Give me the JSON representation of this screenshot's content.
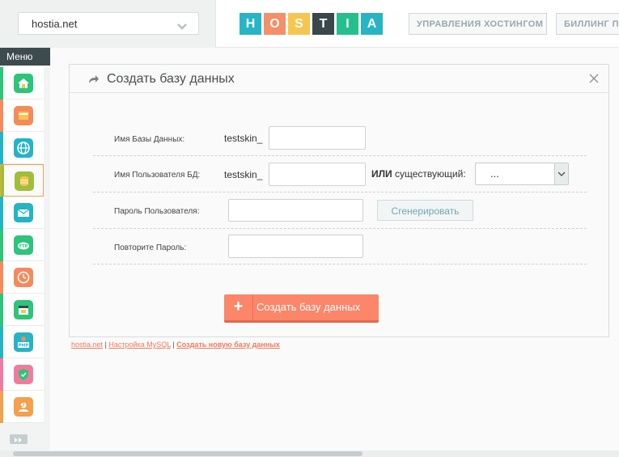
{
  "header": {
    "domain_selector": {
      "value": "hostia.net"
    },
    "logo_letters": [
      {
        "char": "H",
        "color": "#27b5c5"
      },
      {
        "char": "O",
        "color": "#f58f68"
      },
      {
        "char": "S",
        "color": "#f6c64e"
      },
      {
        "char": "T",
        "color": "#3a474b"
      },
      {
        "char": "I",
        "color": "#25bf8d"
      },
      {
        "char": "A",
        "color": "#27b5c5"
      }
    ],
    "nav": [
      {
        "label": "УПРАВЛЕНИЯ ХОСТИНГОМ"
      },
      {
        "label": "БИЛЛИНГ П"
      }
    ]
  },
  "sidebar": {
    "menu_label": "Меню",
    "items": [
      {
        "icon": "home-icon",
        "color": "#2cc57a"
      },
      {
        "icon": "folder-icon",
        "color": "#f58a5a"
      },
      {
        "icon": "www-globe-icon",
        "color": "#25b3c6"
      },
      {
        "icon": "database-icon",
        "color": "#9fbf3b",
        "active": true
      },
      {
        "icon": "mail-icon",
        "color": "#25b3c6"
      },
      {
        "icon": "ftp-cloud-icon",
        "color": "#2cc57a"
      },
      {
        "icon": "clock-icon",
        "color": "#f58a5a"
      },
      {
        "icon": "calendar-icon",
        "color": "#2cc57a"
      },
      {
        "icon": "php-icon",
        "color": "#25b3c6"
      },
      {
        "icon": "shield-icon",
        "color": "#f27aa0"
      },
      {
        "icon": "user-support-icon",
        "color": "#f5a04a"
      }
    ]
  },
  "panel": {
    "title": "Создать базу данных",
    "form": {
      "db_name": {
        "label": "Имя Базы Данных:",
        "prefix": "testskin_",
        "value": ""
      },
      "db_user": {
        "label": "Имя Пользователя БД:",
        "prefix": "testskin_",
        "value": "",
        "or_label": "ИЛИ",
        "existing_label": "существующий:",
        "existing_value": "..."
      },
      "password": {
        "label": "Пароль Пользователя:",
        "value": "",
        "generate_label": "Сгенерировать"
      },
      "password_repeat": {
        "label": "Повторите Пароль:",
        "value": ""
      }
    },
    "submit": {
      "icon": "+",
      "label": "Создать базу данных"
    }
  },
  "breadcrumbs": {
    "items": [
      "hostia.net",
      "Настройка MySQL",
      "Создать новую базу данных"
    ],
    "separator": "|"
  },
  "colors": {
    "accent_orange": "#fb866a",
    "sidebar_dark": "#3d4b4f"
  }
}
